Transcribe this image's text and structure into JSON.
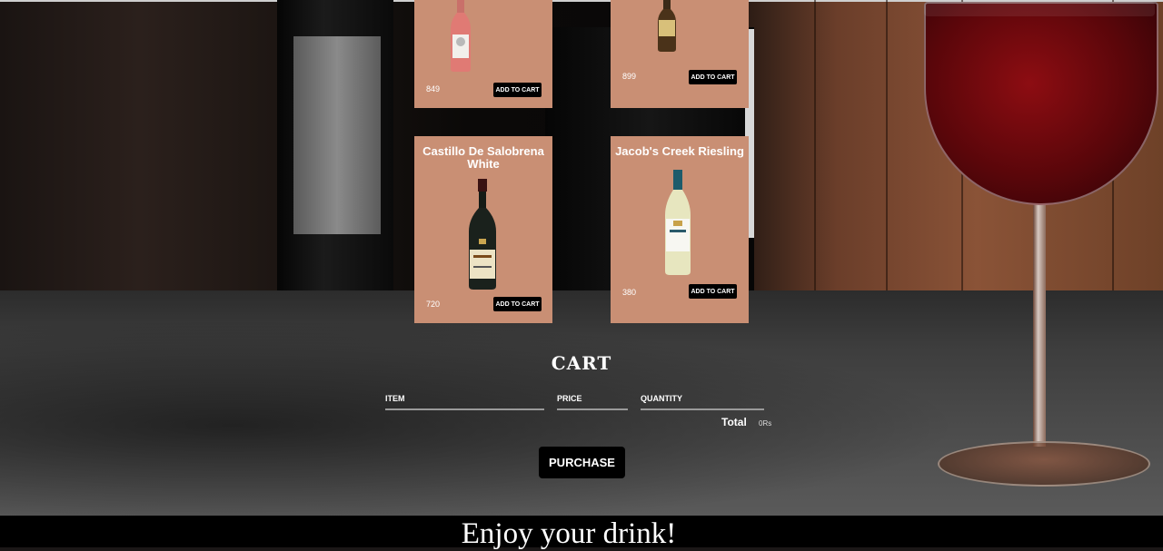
{
  "products": [
    {
      "name": "",
      "price": "849",
      "button": "ADD TO CART"
    },
    {
      "name": "",
      "price": "899",
      "button": "ADD TO CART"
    },
    {
      "name": "Castillo De Salobrena White",
      "price": "720",
      "button": "ADD TO CART"
    },
    {
      "name": "Jacob's Creek Riesling",
      "price": "380",
      "button": "ADD TO CART"
    }
  ],
  "cart": {
    "title": "CART",
    "columns": [
      "ITEM",
      "PRICE",
      "QUANTITY"
    ],
    "total_label": "Total",
    "total_value": "0Rs",
    "purchase_label": "PURCHASE"
  },
  "footer": {
    "text": "Enjoy your drink!"
  },
  "colors": {
    "card": "#c98f74",
    "button": "#000000"
  }
}
